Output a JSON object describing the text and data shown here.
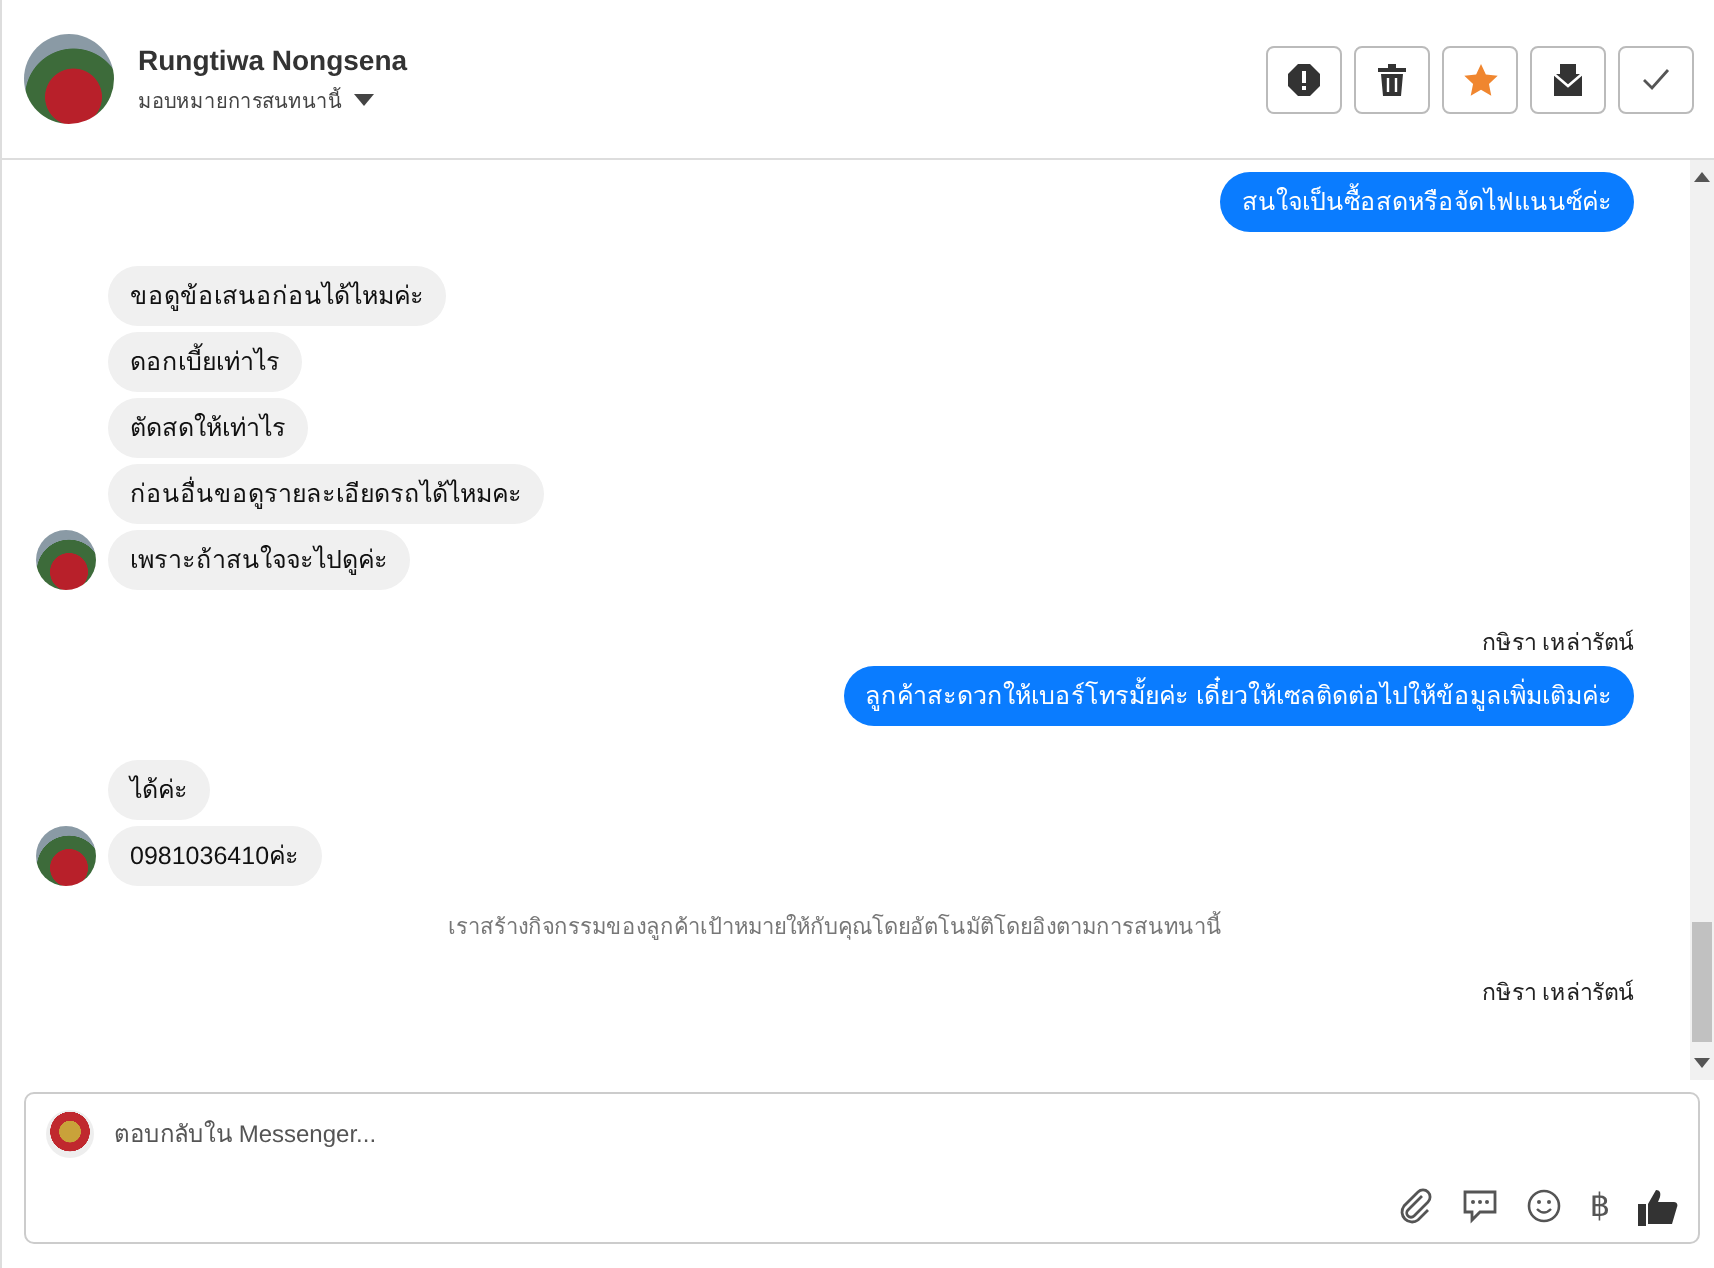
{
  "header": {
    "name": "Rungtiwa Nongsena",
    "assign_label": "มอบหมายการสนทนานี้"
  },
  "actions": [
    {
      "kind": "alert"
    },
    {
      "kind": "trash"
    },
    {
      "kind": "star"
    },
    {
      "kind": "mail"
    },
    {
      "kind": "check"
    }
  ],
  "messages": [
    {
      "kind": "outgoing",
      "text": "สนใจเป็นซื้อสดหรือจัดไฟแนนซ์ค่ะ"
    },
    {
      "kind": "incoming",
      "text": "ขอดูข้อเสนอก่อนได้ไหมค่ะ",
      "avatar": false
    },
    {
      "kind": "incoming",
      "text": "ดอกเบี้ยเท่าไร",
      "avatar": false
    },
    {
      "kind": "incoming",
      "text": "ตัดสดให้เท่าไร",
      "avatar": false
    },
    {
      "kind": "incoming",
      "text": "ก่อนอื่นขอดูรายละเอียดรถได้ไหมคะ",
      "avatar": false
    },
    {
      "kind": "incoming",
      "text": "เพราะถ้าสนใจจะไปดูค่ะ",
      "avatar": true
    },
    {
      "kind": "sender",
      "text": "กษิรา เหล่ารัตน์"
    },
    {
      "kind": "outgoing",
      "text": "ลูกค้าสะดวกให้เบอร์โทรมั้ยค่ะ เดี๋ยวให้เซลติดต่อไปให้ข้อมูลเพิ่มเติมค่ะ"
    },
    {
      "kind": "incoming",
      "text": "ได้ค่ะ",
      "avatar": false
    },
    {
      "kind": "incoming",
      "text": "0981036410ค่ะ",
      "avatar": true
    },
    {
      "kind": "system",
      "text": "เราสร้างกิจกรรมของลูกค้าเป้าหมายให้กับคุณโดยอัตโนมัติโดยอิงตามการสนทนานี้"
    },
    {
      "kind": "sender",
      "text": "กษิรา เหล่ารัตน์"
    }
  ],
  "composer": {
    "placeholder": "ตอบกลับใน Messenger..."
  },
  "composer_tools": [
    {
      "kind": "attach"
    },
    {
      "kind": "comment"
    },
    {
      "kind": "emoji"
    },
    {
      "kind": "baht",
      "text": "฿"
    },
    {
      "kind": "like"
    }
  ]
}
